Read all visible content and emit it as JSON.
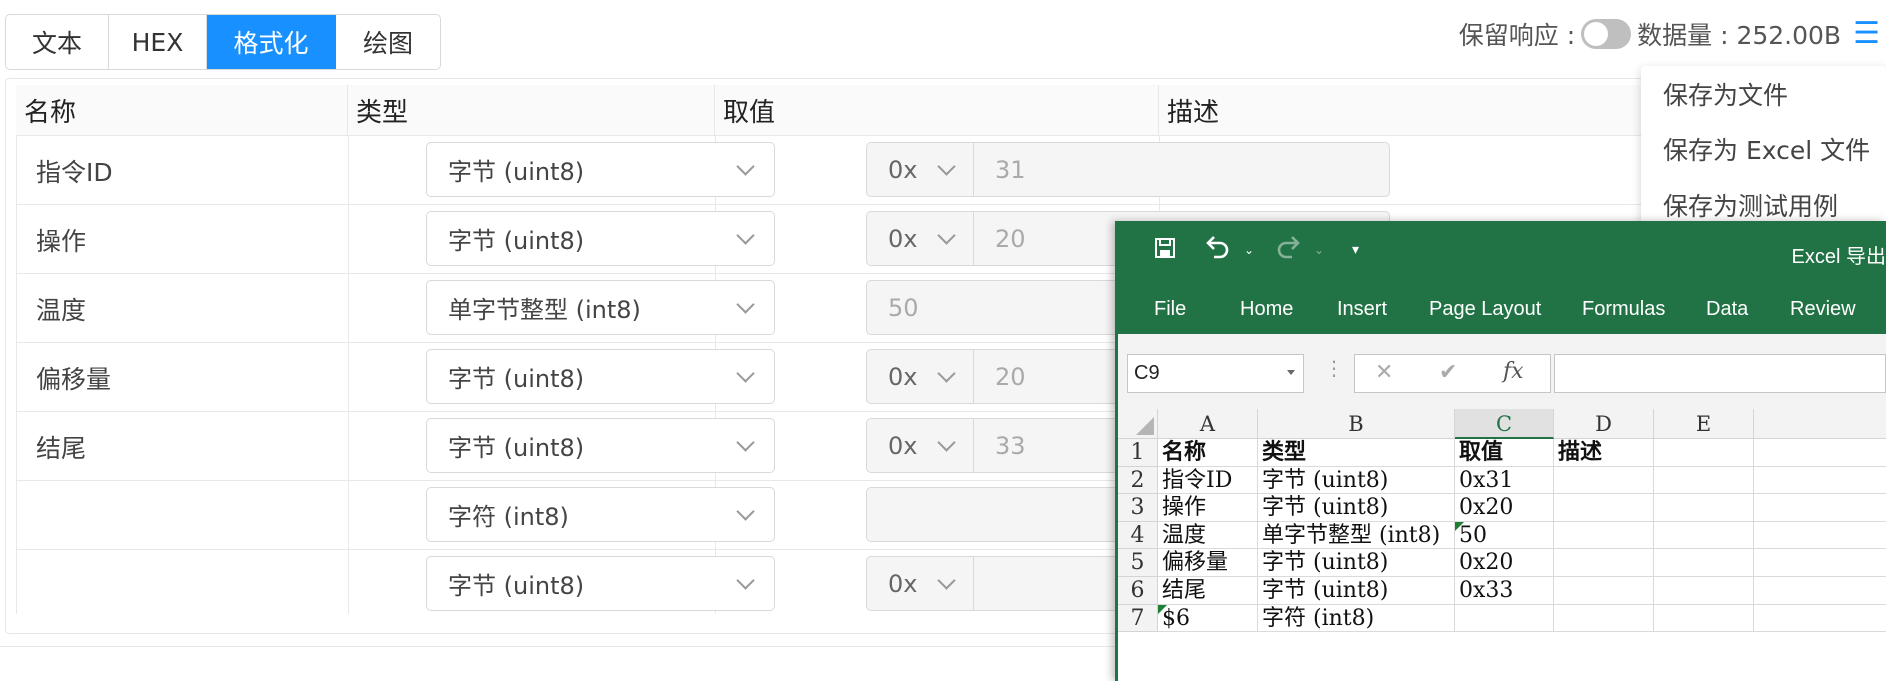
{
  "tabs": [
    {
      "label": "文本",
      "active": false
    },
    {
      "label": "HEX",
      "active": false
    },
    {
      "label": "格式化",
      "active": true
    },
    {
      "label": "绘图",
      "active": false
    }
  ],
  "topbar": {
    "keep_response_label": "保留响应 :",
    "keep_response_on": false,
    "data_size_label": "数据量 : 252.00B",
    "menu_icon": "hamburger-menu-icon"
  },
  "table": {
    "headers": [
      "名称",
      "类型",
      "取值",
      "描述"
    ],
    "rows": [
      {
        "name": "指令ID",
        "type": "字节 (uint8)",
        "prefix": "0x",
        "value": "31"
      },
      {
        "name": "操作",
        "type": "字节 (uint8)",
        "prefix": "0x",
        "value": "20"
      },
      {
        "name": "温度",
        "type": "单字节整型 (int8)",
        "prefix": "",
        "value": "50"
      },
      {
        "name": "偏移量",
        "type": "字节 (uint8)",
        "prefix": "0x",
        "value": "20"
      },
      {
        "name": "结尾",
        "type": "字节 (uint8)",
        "prefix": "0x",
        "value": "33"
      },
      {
        "name": "",
        "type": "字符 (int8)",
        "prefix": "",
        "value": ""
      },
      {
        "name": "",
        "type": "字节 (uint8)",
        "prefix": "0x",
        "value": ""
      }
    ]
  },
  "dropdown": {
    "items": [
      "保存为文件",
      "保存为 Excel 文件",
      "保存为测试用例"
    ]
  },
  "excel": {
    "title": "Excel 导出",
    "ribbon_tabs": [
      "File",
      "Home",
      "Insert",
      "Page Layout",
      "Formulas",
      "Data",
      "Review"
    ],
    "name_box": "C9",
    "cancel_symbol": "✕",
    "enter_symbol": "✔",
    "fx_symbol": "fx",
    "columns": [
      "A",
      "B",
      "C",
      "D",
      "E"
    ],
    "selected_column": "C",
    "row_numbers": [
      "1",
      "2",
      "3",
      "4",
      "5",
      "6",
      "7"
    ],
    "cells": [
      [
        "名称",
        "类型",
        "取值",
        "描述",
        ""
      ],
      [
        "指令ID",
        "字节 (uint8)",
        "0x31",
        "",
        ""
      ],
      [
        "操作",
        "字节 (uint8)",
        "0x20",
        "",
        ""
      ],
      [
        "温度",
        "单字节整型 (int8)",
        "50",
        "",
        ""
      ],
      [
        "偏移量",
        "字节 (uint8)",
        "0x20",
        "",
        ""
      ],
      [
        "结尾",
        "字节 (uint8)",
        "0x33",
        "",
        ""
      ],
      [
        "$6",
        "字符 (int8)",
        "",
        "",
        ""
      ]
    ],
    "accent_color": "#217346"
  },
  "colors": {
    "primary": "#1890ff",
    "excel_green": "#217346"
  }
}
